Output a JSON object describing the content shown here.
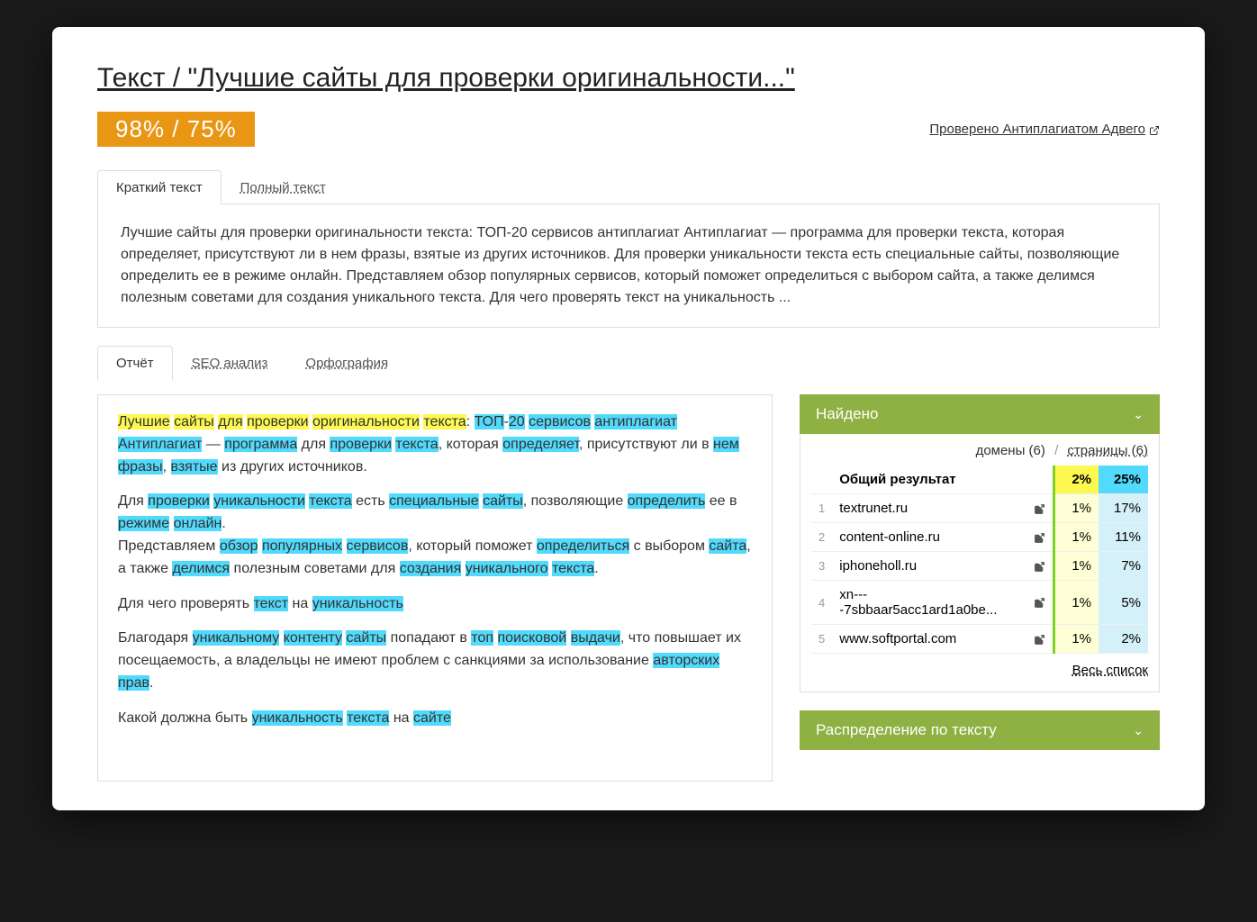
{
  "title": "Текст / \"Лучшие сайты для проверки оригинальности...\"",
  "score": "98% / 75%",
  "checked_by": "Проверено Антиплагиатом Адвего",
  "text_tabs": {
    "short": "Краткий текст",
    "full": "Полный текст"
  },
  "summary": "Лучшие сайты для проверки оригинальности текста: ТОП-20 сервисов антиплагиат Антиплагиат — программа для проверки текста, которая определяет, присутствуют ли в нем фразы, взятые из других источников. Для проверки уникальности текста есть специальные сайты, позволяющие определить ее в режиме онлайн. Представляем обзор популярных сервисов, который поможет определиться с выбором сайта, а также делимся полезным советами для создания уникального текста. Для чего проверять текст на уникальность ...",
  "report_tabs": {
    "report": "Отчёт",
    "seo": "SEO анализ",
    "spell": "Орфография"
  },
  "found": {
    "header": "Найдено",
    "domains_label": "домены (6)",
    "pages_label": "страницы (6)",
    "total_label": "Общий результат",
    "total_p1": "2%",
    "total_p2": "25%",
    "rows": [
      {
        "name": "textrunet.ru",
        "p1": "1%",
        "p2": "17%"
      },
      {
        "name": "content-online.ru",
        "p1": "1%",
        "p2": "11%"
      },
      {
        "name": "iphoneholl.ru",
        "p1": "1%",
        "p2": "7%"
      },
      {
        "name": "xn----7sbbaar5acc1ard1a0be...",
        "p1": "1%",
        "p2": "5%"
      },
      {
        "name": "www.softportal.com",
        "p1": "1%",
        "p2": "2%"
      }
    ],
    "all_list": "Весь список"
  },
  "distribution_header": "Распределение по тексту"
}
